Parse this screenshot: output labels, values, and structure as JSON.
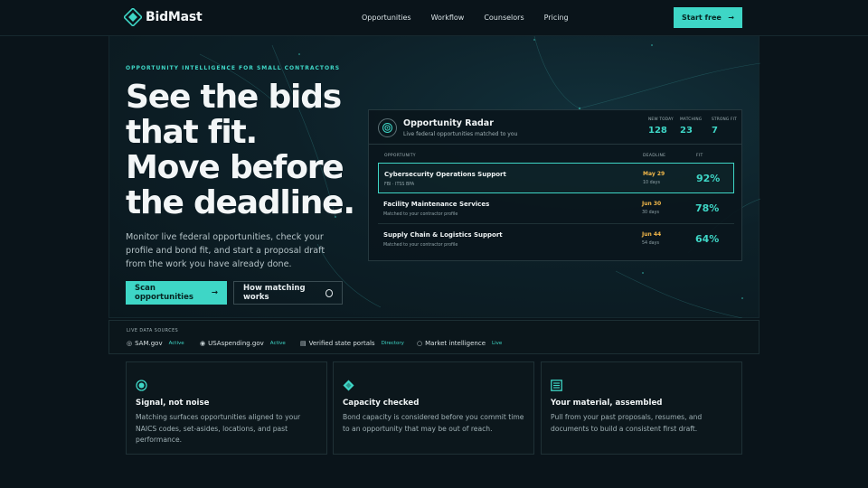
{
  "brand": {
    "name": "BidMast",
    "accent": "#3ed6c6"
  },
  "nav": {
    "links": [
      "Opportunities",
      "Workflow",
      "Counselors",
      "Pricing"
    ],
    "cta_label": "Start free",
    "cta_arrow": "→"
  },
  "hero": {
    "eyebrow": "OPPORTUNITY INTELLIGENCE FOR SMALL CONTRACTORS",
    "headline_lines": [
      "See the bids",
      "that fit.",
      "Move before",
      "the deadline."
    ],
    "subtext": "Monitor live federal opportunities, check your profile and bond fit, and start a proposal draft from the work you have already done.",
    "primary_button": "Scan opportunities",
    "primary_arrow": "→",
    "secondary_button": "How matching works"
  },
  "radar": {
    "title": "Opportunity Radar",
    "subtitle": "Live federal opportunities matched to you",
    "stats": [
      {
        "label": "NEW TODAY",
        "value": "128"
      },
      {
        "label": "MATCHING",
        "value": "23"
      },
      {
        "label": "STRONG FIT",
        "value": "7"
      }
    ],
    "columns": [
      "OPPORTUNITY",
      "DEADLINE",
      "FIT"
    ],
    "rows": [
      {
        "name": "Cybersecurity Operations Support",
        "meta": "FBI · ITSS BPA",
        "date": "May 29",
        "days": "10 days",
        "fit": "92%"
      },
      {
        "name": "Facility Maintenance Services",
        "meta": "Matched to your contractor profile",
        "date": "Jun 30",
        "days": "30 days",
        "fit": "78%"
      },
      {
        "name": "Supply Chain & Logistics Support",
        "meta": "Matched to your contractor profile",
        "date": "Jun 44",
        "days": "54 days",
        "fit": "64%"
      }
    ]
  },
  "sources": {
    "label": "LIVE DATA SOURCES",
    "items": [
      {
        "icon": "◎",
        "name": "SAM.gov",
        "status": "Active"
      },
      {
        "icon": "◉",
        "name": "USAspending.gov",
        "status": "Active"
      },
      {
        "icon": "▤",
        "name": "Verified state portals",
        "status": "Directory"
      },
      {
        "icon": "○",
        "name": "Market intelligence",
        "status": "Live"
      }
    ]
  },
  "features": [
    {
      "icon": "target-icon",
      "title": "Signal, not noise",
      "text": "Matching surfaces opportunities aligned to your NAICS codes, set-asides, locations, and past performance."
    },
    {
      "icon": "diamond-icon",
      "title": "Capacity checked",
      "text": "Bond capacity is considered before you commit time to an opportunity that may be out of reach."
    },
    {
      "icon": "document-icon",
      "title": "Your material, assembled",
      "text": "Pull from your past proposals, resumes, and documents to build a consistent first draft."
    }
  ]
}
